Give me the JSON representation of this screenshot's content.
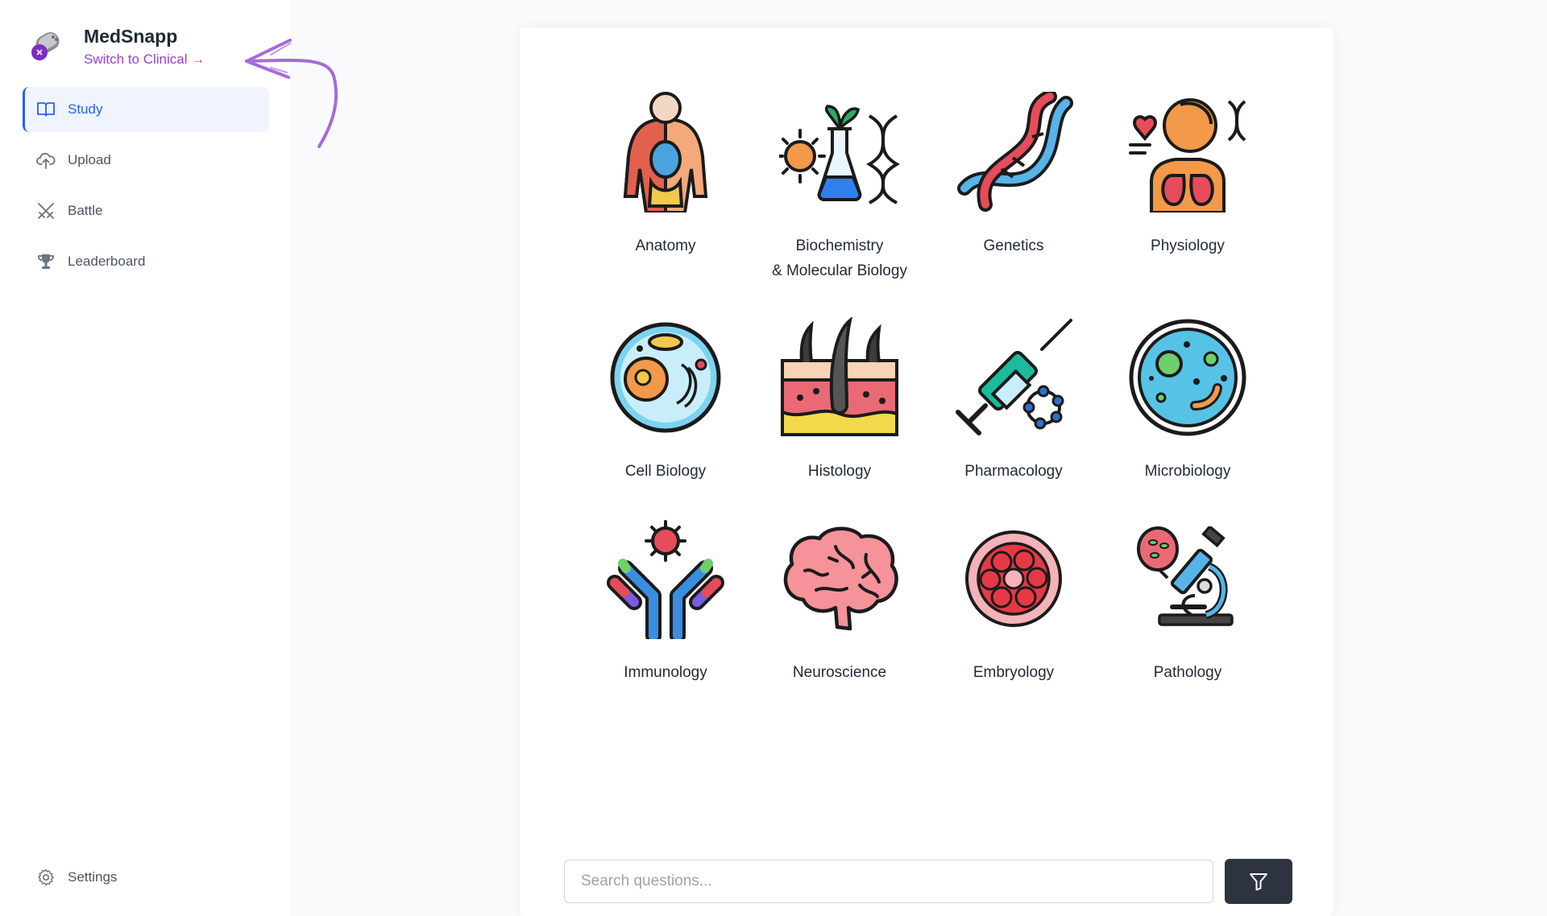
{
  "brand": {
    "title": "MedSnapp",
    "switch_link": "Switch to Clinical →",
    "accent": "#9b3fdb"
  },
  "nav": {
    "items": [
      {
        "label": "Study",
        "icon": "book-open-icon",
        "active": true
      },
      {
        "label": "Upload",
        "icon": "cloud-upload-icon",
        "active": false
      },
      {
        "label": "Battle",
        "icon": "crossed-swords-icon",
        "active": false
      },
      {
        "label": "Leaderboard",
        "icon": "trophy-icon",
        "active": false
      }
    ],
    "settings": {
      "label": "Settings",
      "icon": "gear-icon"
    }
  },
  "categories": [
    {
      "label": "Anatomy",
      "icon": "anatomy-icon"
    },
    {
      "label": "Biochemistry\n& Molecular Biology",
      "icon": "biochemistry-flask-icon"
    },
    {
      "label": "Genetics",
      "icon": "dna-icon"
    },
    {
      "label": "Physiology",
      "icon": "physiology-icon"
    },
    {
      "label": "Cell Biology",
      "icon": "cell-icon"
    },
    {
      "label": "Histology",
      "icon": "skin-tissue-icon"
    },
    {
      "label": "Pharmacology",
      "icon": "syringe-icon"
    },
    {
      "label": "Microbiology",
      "icon": "petri-dish-icon"
    },
    {
      "label": "Immunology",
      "icon": "antibody-icon"
    },
    {
      "label": "Neuroscience",
      "icon": "brain-icon"
    },
    {
      "label": "Embryology",
      "icon": "embryo-icon"
    },
    {
      "label": "Pathology",
      "icon": "microscope-icon"
    }
  ],
  "search": {
    "placeholder": "Search questions...",
    "value": ""
  },
  "filter_button": {
    "icon": "filter-icon"
  },
  "colors": {
    "active_nav": "#2563eb",
    "active_nav_bg": "#eff4ff",
    "filter_button_bg": "#2d3440"
  }
}
